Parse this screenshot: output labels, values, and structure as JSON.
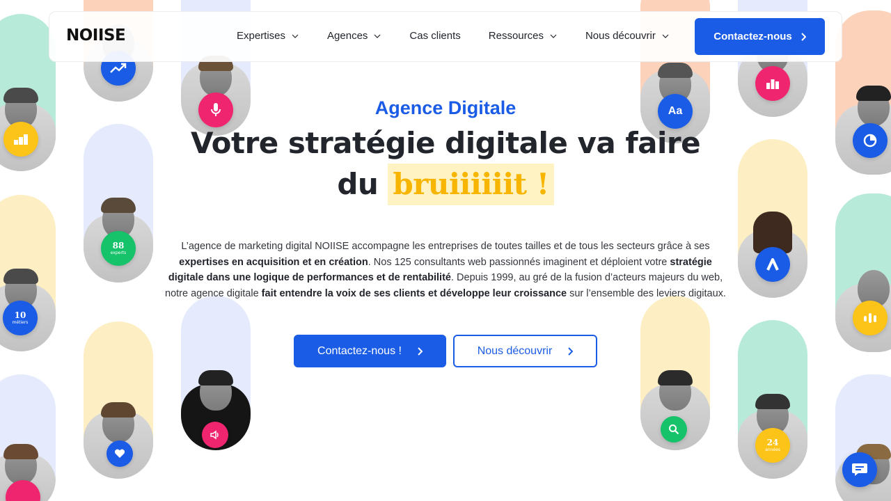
{
  "header": {
    "logo": "NOIISE",
    "nav": [
      {
        "label": "Expertises",
        "has_dropdown": true
      },
      {
        "label": "Agences",
        "has_dropdown": true
      },
      {
        "label": "Cas clients",
        "has_dropdown": false
      },
      {
        "label": "Ressources",
        "has_dropdown": true
      },
      {
        "label": "Nous découvrir",
        "has_dropdown": true
      }
    ],
    "cta": "Contactez-nous"
  },
  "hero": {
    "eyebrow": "Agence Digitale",
    "title_line1": "Votre stratégie digitale va faire",
    "title_line2_prefix": "du",
    "title_highlight": "bruiiiiiit !",
    "description": {
      "p1": "L’agence de marketing digital NOIISE accompagne les entreprises de toutes tailles et de tous les secteurs grâce à ses ",
      "b1": "expertises en acquisition et en création",
      "p2": ". Nos 125 consultants web passionnés imaginent et déploient votre ",
      "b2": "stratégie digitale dans une logique de performances et de rentabilité",
      "p3": ". Depuis 1999, au gré de la fusion d’acteurs majeurs du web, notre agence digitale ",
      "b3": "fait entendre la voix de ses clients et développe leur croissance",
      "p4": " sur l’ensemble des leviers digitaux."
    },
    "cta_primary": "Contactez-nous !",
    "cta_secondary": "Nous découvrir"
  },
  "badges": {
    "experts_number": "88",
    "experts_label": "experts",
    "metiers_number": "10",
    "metiers_label": "métiers",
    "annees_number": "24",
    "annees_label": "années",
    "font_icon_text": "Aa"
  },
  "colors": {
    "brand_blue": "#1a5ce6",
    "highlight_yellow": "#f7b500",
    "highlight_bg": "#fff3c4",
    "pink": "#f0256f",
    "green": "#16c26a",
    "yellow": "#fcc419",
    "mint": "#b7ead9",
    "peach": "#fcd2bb",
    "lavender": "#e5ebfc",
    "cream": "#fdefc3"
  }
}
